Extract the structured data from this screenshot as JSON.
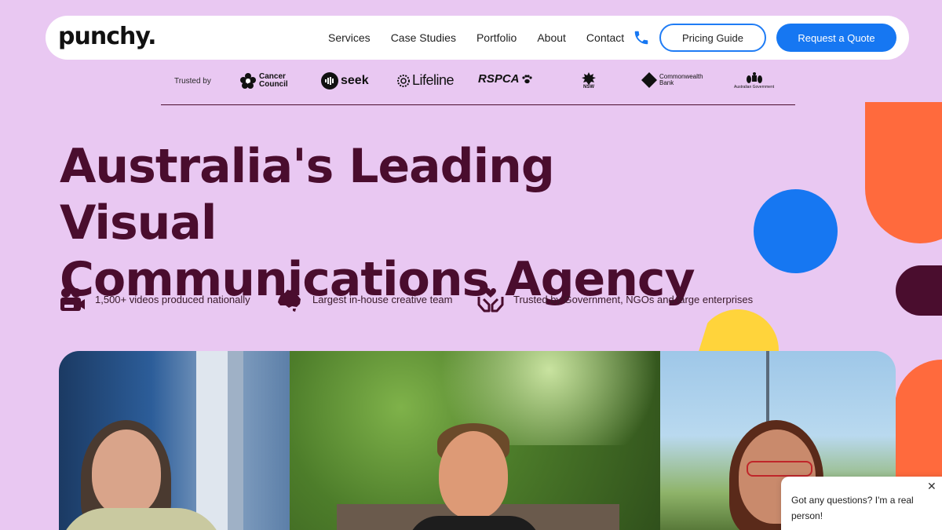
{
  "brand": {
    "logo_text": "punchy."
  },
  "nav": {
    "links": [
      "Services",
      "Case Studies",
      "Portfolio",
      "About",
      "Contact"
    ],
    "phone_icon": "phone-icon",
    "pricing_label": "Pricing Guide",
    "quote_label": "Request a Quote"
  },
  "trusted": {
    "label": "Trusted by",
    "logos": {
      "cancer": "Cancer Council",
      "seek": "seek",
      "lifeline": "Lifeline",
      "rspca": "RSPCA",
      "nsw": "NSW",
      "cba": "Commonwealth Bank",
      "aus": "Australian Government"
    }
  },
  "hero": {
    "line1": "Australia's Leading Visual",
    "line2": "Communications Agency"
  },
  "features": [
    {
      "icon": "video-camera-icon",
      "text": "1,500+ videos produced nationally"
    },
    {
      "icon": "australia-map-icon",
      "text": "Largest in-house creative team"
    },
    {
      "icon": "heart-hands-icon",
      "text": "Trusted by Government, NGOs and large enterprises"
    }
  ],
  "colors": {
    "background": "#e9c8f2",
    "maroon": "#4a0d2e",
    "blue": "#1677f2",
    "orange": "#ff6a3d",
    "yellow": "#ffd43b"
  },
  "chat": {
    "message": "Got any questions? I'm a real person!",
    "close": "✕"
  }
}
